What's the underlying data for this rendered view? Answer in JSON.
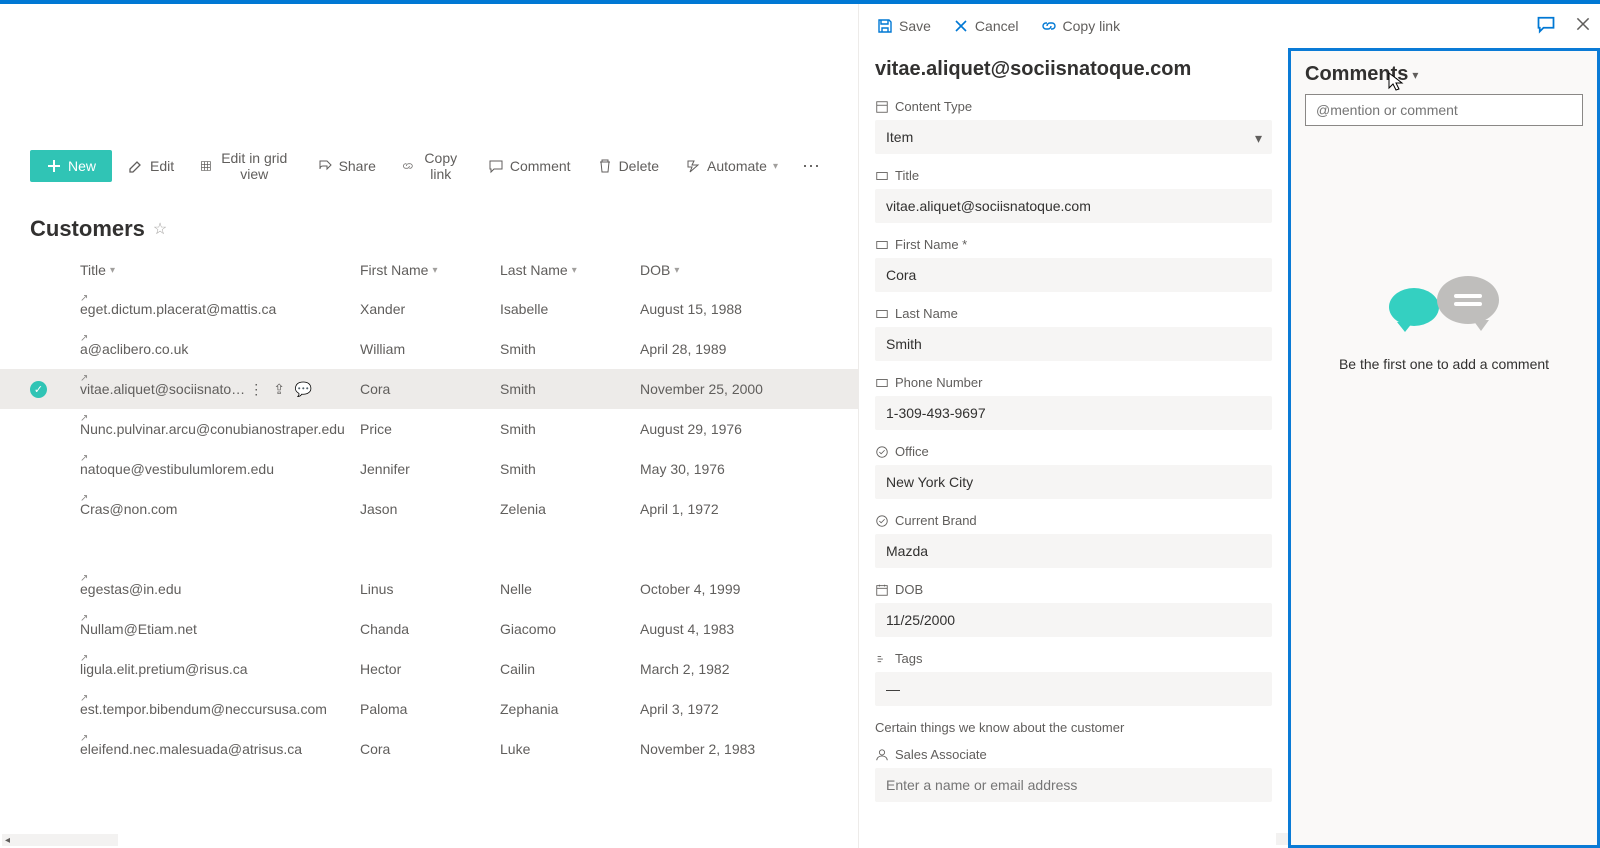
{
  "toolbar": {
    "new": "New",
    "edit": "Edit",
    "edit_grid": "Edit in grid view",
    "share": "Share",
    "copy_link": "Copy link",
    "comment": "Comment",
    "delete": "Delete",
    "automate": "Automate"
  },
  "list": {
    "title": "Customers",
    "columns": {
      "title": "Title",
      "first_name": "First Name",
      "last_name": "Last Name",
      "dob": "DOB"
    },
    "rows": [
      {
        "title": "eget.dictum.placerat@mattis.ca",
        "fn": "Xander",
        "ln": "Isabelle",
        "dob": "August 15, 1988"
      },
      {
        "title": "a@aclibero.co.uk",
        "fn": "William",
        "ln": "Smith",
        "dob": "April 28, 1989"
      },
      {
        "title": "vitae.aliquet@sociisnato…",
        "fn": "Cora",
        "ln": "Smith",
        "dob": "November 25, 2000",
        "selected": true
      },
      {
        "title": "Nunc.pulvinar.arcu@conubianostraper.edu",
        "fn": "Price",
        "ln": "Smith",
        "dob": "August 29, 1976"
      },
      {
        "title": "natoque@vestibulumlorem.edu",
        "fn": "Jennifer",
        "ln": "Smith",
        "dob": "May 30, 1976"
      },
      {
        "title": "Cras@non.com",
        "fn": "Jason",
        "ln": "Zelenia",
        "dob": "April 1, 1972"
      },
      {
        "title": "egestas@in.edu",
        "fn": "Linus",
        "ln": "Nelle",
        "dob": "October 4, 1999"
      },
      {
        "title": "Nullam@Etiam.net",
        "fn": "Chanda",
        "ln": "Giacomo",
        "dob": "August 4, 1983"
      },
      {
        "title": "ligula.elit.pretium@risus.ca",
        "fn": "Hector",
        "ln": "Cailin",
        "dob": "March 2, 1982"
      },
      {
        "title": "est.tempor.bibendum@neccursusa.com",
        "fn": "Paloma",
        "ln": "Zephania",
        "dob": "April 3, 1972"
      },
      {
        "title": "eleifend.nec.malesuada@atrisus.ca",
        "fn": "Cora",
        "ln": "Luke",
        "dob": "November 2, 1983"
      }
    ]
  },
  "detail": {
    "toolbar": {
      "save": "Save",
      "cancel": "Cancel",
      "copy_link": "Copy link"
    },
    "title": "vitae.aliquet@sociisnatoque.com",
    "fields": {
      "content_type": {
        "label": "Content Type",
        "value": "Item"
      },
      "title_f": {
        "label": "Title",
        "value": "vitae.aliquet@sociisnatoque.com"
      },
      "first_name": {
        "label": "First Name *",
        "value": "Cora"
      },
      "last_name": {
        "label": "Last Name",
        "value": "Smith"
      },
      "phone": {
        "label": "Phone Number",
        "value": "1-309-493-9697"
      },
      "office": {
        "label": "Office",
        "value": "New York City"
      },
      "brand": {
        "label": "Current Brand",
        "value": "Mazda"
      },
      "dob": {
        "label": "DOB",
        "value": "11/25/2000"
      },
      "tags": {
        "label": "Tags",
        "value": "—"
      },
      "sales_assoc": {
        "label": "Sales Associate",
        "placeholder": "Enter a name or email address"
      }
    },
    "helper_brand": "Certain things we know about the customer"
  },
  "comments": {
    "header": "Comments",
    "placeholder": "@mention or comment",
    "empty_text": "Be the first one to add a comment"
  }
}
